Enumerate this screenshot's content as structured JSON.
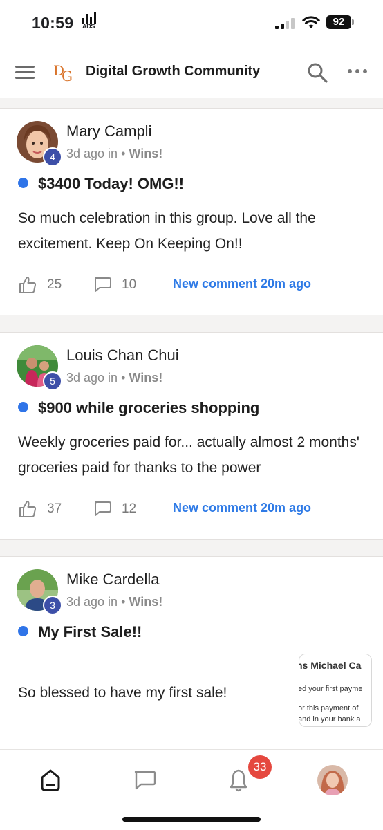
{
  "status_bar": {
    "time": "10:59",
    "ads_label": "ADS",
    "battery": "92"
  },
  "header": {
    "title": "Digital Growth Community",
    "logo_d": "D",
    "logo_g": "G"
  },
  "posts": [
    {
      "author": "Mary Campli",
      "level": "4",
      "time": "3d ago in",
      "sep": "•",
      "category": "Wins!",
      "title": "$3400 Today! OMG!!",
      "body": "So much celebration in this group. Love all the excitement. Keep On Keeping On!!",
      "likes": "25",
      "comments": "10",
      "new_comment": "New comment 20m ago"
    },
    {
      "author": "Louis Chan Chui",
      "level": "5",
      "time": "3d ago in",
      "sep": "•",
      "category": "Wins!",
      "title": "$900 while groceries shopping",
      "body": "Weekly groceries paid for... actually almost 2 months' groceries paid for thanks to the power",
      "likes": "37",
      "comments": "12",
      "new_comment": "New comment 20m ago"
    },
    {
      "author": "Mike Cardella",
      "level": "3",
      "time": "3d ago in",
      "sep": "•",
      "category": "Wins!",
      "title": "My First Sale!!",
      "body": "So blessed to have my first sale!",
      "thumbnail": {
        "line1": "ns Michael Ca",
        "line2": "ed your first payme",
        "line3": "or this payment of",
        "line4": "and in your bank a"
      }
    }
  ],
  "bottom_nav": {
    "notifications_count": "33"
  },
  "colors": {
    "accent": "#2e7ae6",
    "level_badge": "#3d4fa8",
    "notification_badge": "#e5483f",
    "logo": "#d9742b"
  }
}
